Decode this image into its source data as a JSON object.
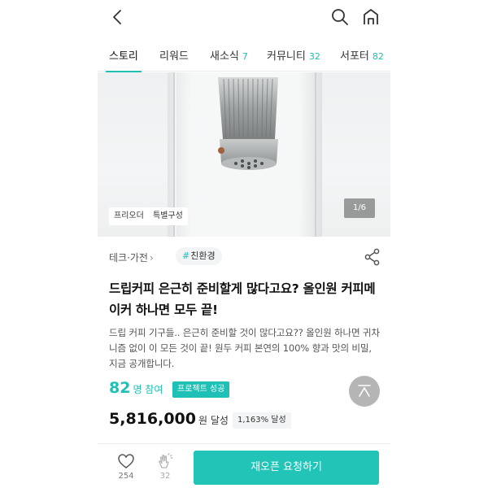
{
  "header": {
    "back_icon": "chevron-left-icon",
    "search_icon": "search-icon",
    "home_icon": "home-icon"
  },
  "tabs": [
    {
      "label": "스토리",
      "count": ""
    },
    {
      "label": "리워드",
      "count": ""
    },
    {
      "label": "새소식",
      "count": "7"
    },
    {
      "label": "커뮤니티",
      "count": "32"
    },
    {
      "label": "서포터",
      "count": "82"
    }
  ],
  "hero": {
    "chips": [
      "프리오더",
      "특별구성"
    ],
    "counter": "1/6"
  },
  "project": {
    "category": "테크·가전",
    "tag": "친환경",
    "title": "드립커피 은근히 준비할게 많다고요? 올인원 커피메이커 하나면 모두 끝!",
    "description": "드립 커피 기구들.. 은근히 준비할 것이 많다고요?? 올인원 하나면 귀차니즘 없이 이 모든 것이 끝! 원두 커피 본연의 100% 향과 맛의 비밀, 지금 공개합니다.",
    "participants": "82",
    "participants_label": "명 참여",
    "status_badge": "프로젝트 성공",
    "amount": "5,816,000",
    "amount_label": "원 달성",
    "percent": "1,163% 달성"
  },
  "bottom": {
    "likes": "254",
    "claps": "32",
    "reopen_label": "재오픈 요청하기"
  },
  "colors": {
    "accent": "#1fc0b5",
    "button": "#22c4b8"
  }
}
